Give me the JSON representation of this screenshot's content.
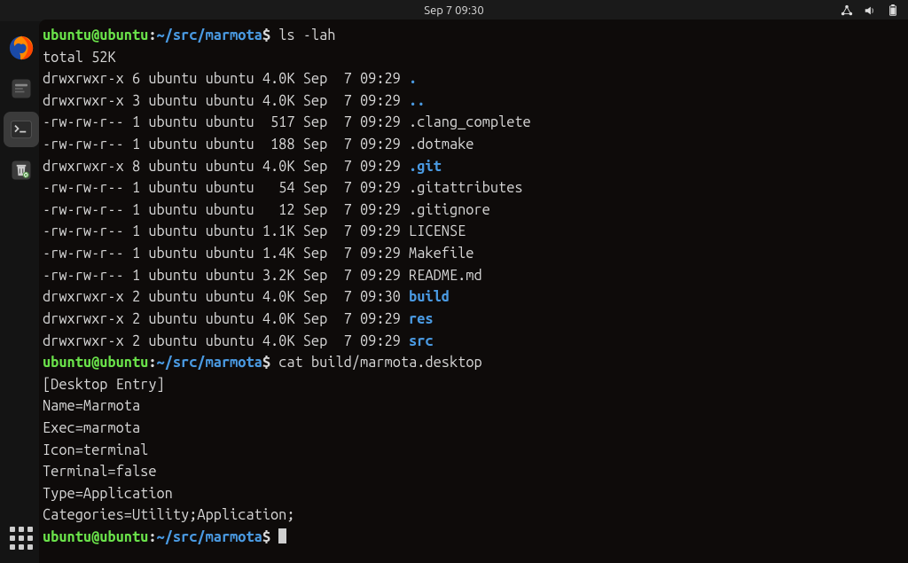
{
  "topbar": {
    "clock": "Sep 7  09:30"
  },
  "dock": {
    "items": [
      {
        "name": "firefox"
      },
      {
        "name": "files"
      },
      {
        "name": "terminal",
        "active": true
      },
      {
        "name": "trash"
      }
    ]
  },
  "term": {
    "user": "ubuntu@ubuntu",
    "sep1": ":",
    "path": "~/src/marmota",
    "dollar": "$ ",
    "cmd1": "ls -lah",
    "total": "total 52K",
    "rows": [
      {
        "perm": "drwxrwxr-x",
        "links": "6",
        "owner": "ubuntu",
        "group": "ubuntu",
        "size": "4.0K",
        "date": "Sep  7 09:29",
        "name": ".",
        "cls": "dir"
      },
      {
        "perm": "drwxrwxr-x",
        "links": "3",
        "owner": "ubuntu",
        "group": "ubuntu",
        "size": "4.0K",
        "date": "Sep  7 09:29",
        "name": "..",
        "cls": "dir"
      },
      {
        "perm": "-rw-rw-r--",
        "links": "1",
        "owner": "ubuntu",
        "group": "ubuntu",
        "size": " 517",
        "date": "Sep  7 09:29",
        "name": ".clang_complete",
        "cls": ""
      },
      {
        "perm": "-rw-rw-r--",
        "links": "1",
        "owner": "ubuntu",
        "group": "ubuntu",
        "size": " 188",
        "date": "Sep  7 09:29",
        "name": ".dotmake",
        "cls": ""
      },
      {
        "perm": "drwxrwxr-x",
        "links": "8",
        "owner": "ubuntu",
        "group": "ubuntu",
        "size": "4.0K",
        "date": "Sep  7 09:29",
        "name": ".git",
        "cls": "dir"
      },
      {
        "perm": "-rw-rw-r--",
        "links": "1",
        "owner": "ubuntu",
        "group": "ubuntu",
        "size": "  54",
        "date": "Sep  7 09:29",
        "name": ".gitattributes",
        "cls": ""
      },
      {
        "perm": "-rw-rw-r--",
        "links": "1",
        "owner": "ubuntu",
        "group": "ubuntu",
        "size": "  12",
        "date": "Sep  7 09:29",
        "name": ".gitignore",
        "cls": ""
      },
      {
        "perm": "-rw-rw-r--",
        "links": "1",
        "owner": "ubuntu",
        "group": "ubuntu",
        "size": "1.1K",
        "date": "Sep  7 09:29",
        "name": "LICENSE",
        "cls": ""
      },
      {
        "perm": "-rw-rw-r--",
        "links": "1",
        "owner": "ubuntu",
        "group": "ubuntu",
        "size": "1.4K",
        "date": "Sep  7 09:29",
        "name": "Makefile",
        "cls": ""
      },
      {
        "perm": "-rw-rw-r--",
        "links": "1",
        "owner": "ubuntu",
        "group": "ubuntu",
        "size": "3.2K",
        "date": "Sep  7 09:29",
        "name": "README.md",
        "cls": ""
      },
      {
        "perm": "drwxrwxr-x",
        "links": "2",
        "owner": "ubuntu",
        "group": "ubuntu",
        "size": "4.0K",
        "date": "Sep  7 09:30",
        "name": "build",
        "cls": "dir"
      },
      {
        "perm": "drwxrwxr-x",
        "links": "2",
        "owner": "ubuntu",
        "group": "ubuntu",
        "size": "4.0K",
        "date": "Sep  7 09:29",
        "name": "res",
        "cls": "dir"
      },
      {
        "perm": "drwxrwxr-x",
        "links": "2",
        "owner": "ubuntu",
        "group": "ubuntu",
        "size": "4.0K",
        "date": "Sep  7 09:29",
        "name": "src",
        "cls": "dir"
      }
    ],
    "cmd2": "cat build/marmota.desktop",
    "cat_output": [
      "[Desktop Entry]",
      "Name=Marmota",
      "Exec=marmota",
      "Icon=terminal",
      "Terminal=false",
      "Type=Application",
      "Categories=Utility;Application;"
    ]
  }
}
